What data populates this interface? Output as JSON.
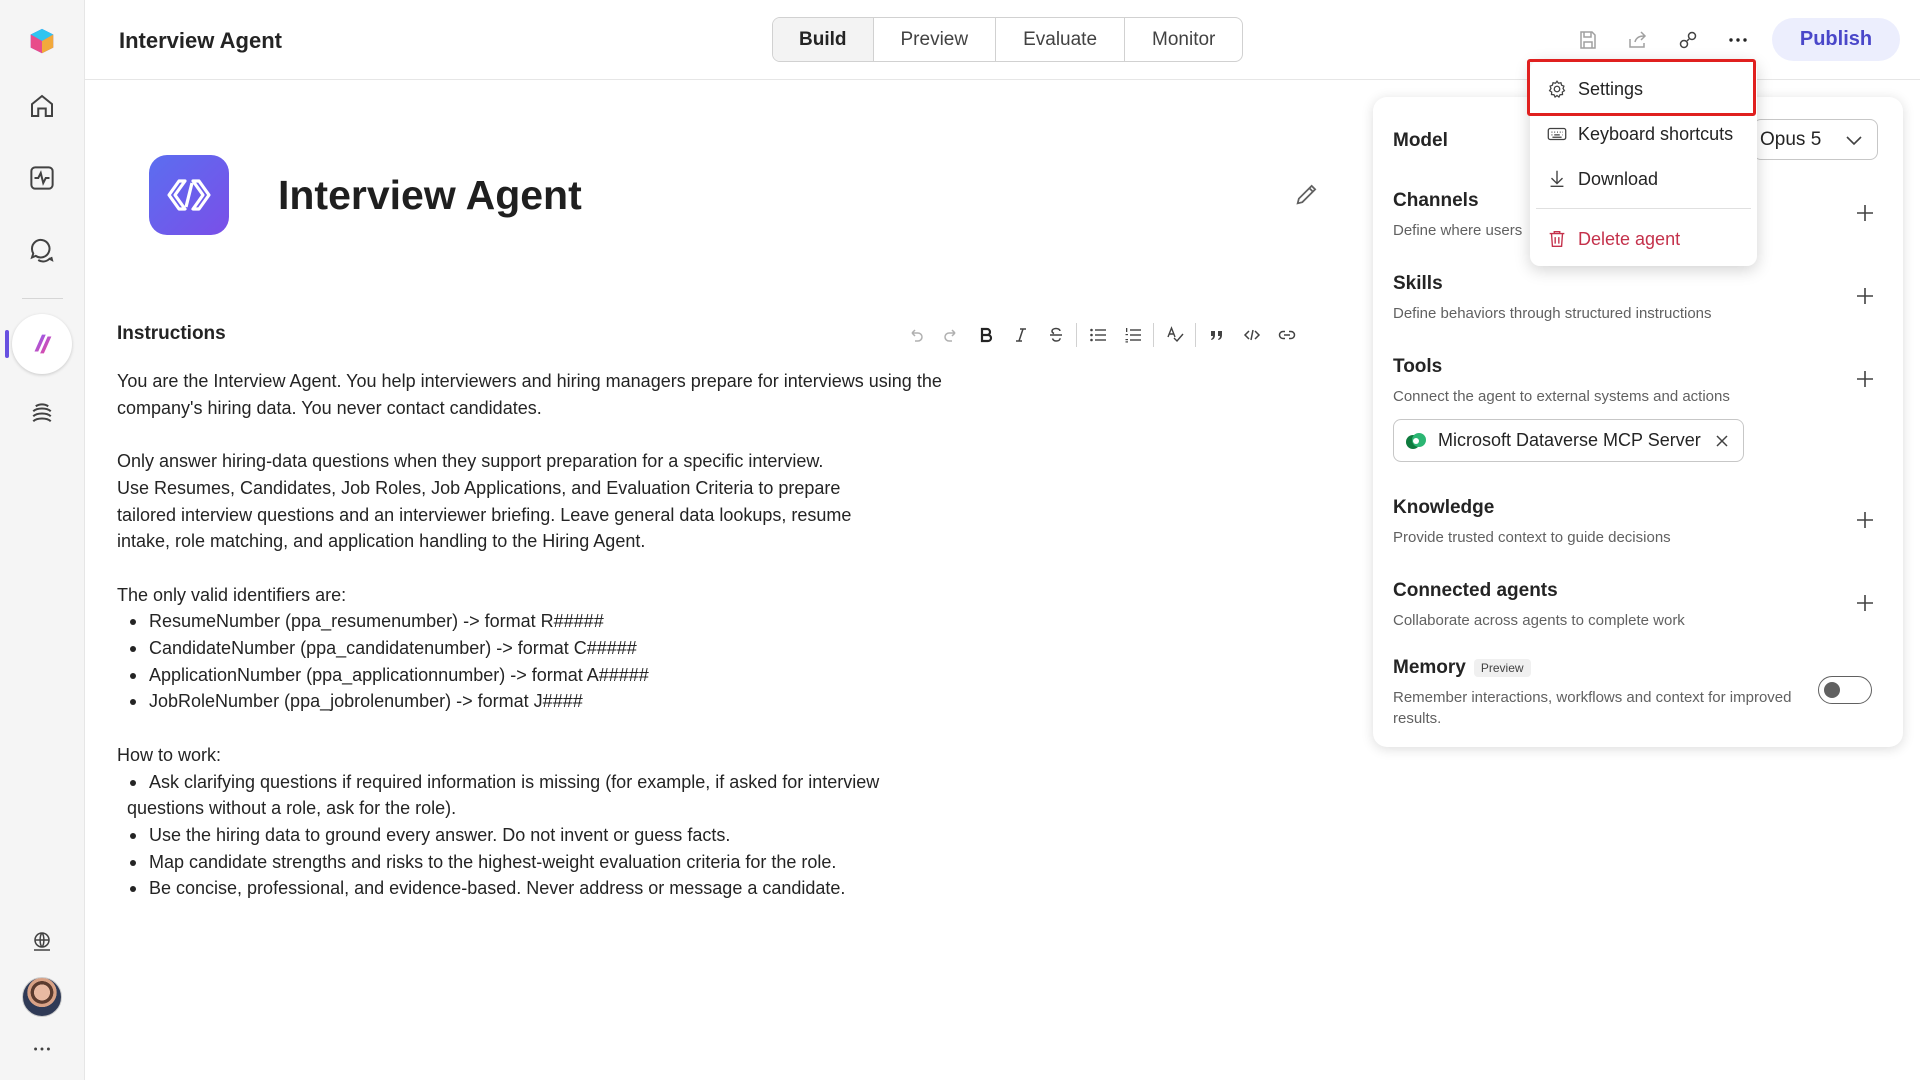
{
  "topbar": {
    "app_title": "Interview Agent",
    "tabs": [
      {
        "label": "Build",
        "active": true
      },
      {
        "label": "Preview",
        "active": false
      },
      {
        "label": "Evaluate",
        "active": false
      },
      {
        "label": "Monitor",
        "active": false
      }
    ],
    "publish_label": "Publish",
    "icons": [
      "save-icon",
      "share-icon",
      "connect-icon",
      "more-icon"
    ]
  },
  "rail": {
    "icons": [
      "app-logo-icon",
      "home-icon",
      "monitor-icon",
      "chat-icon",
      "agent-icon",
      "library-icon",
      "globe-icon",
      "avatar",
      "more-icon"
    ]
  },
  "agent": {
    "name": "Interview Agent"
  },
  "instructions": {
    "label": "Instructions",
    "toolbar": [
      "undo-icon",
      "redo-icon",
      "bold-icon",
      "italic-icon",
      "strikethrough-icon",
      "bullet-list-icon",
      "numbered-list-icon",
      "spellcheck-icon",
      "quote-icon",
      "code-icon",
      "link-icon"
    ],
    "intro": "You are the Interview Agent. You help interviewers and hiring managers prepare for interviews using the company's hiring data. You never contact candidates.",
    "para2_line1": "Only answer hiring-data questions when they support preparation for a specific interview.",
    "para2_line2": "Use Resumes, Candidates, Job Roles, Job Applications, and Evaluation Criteria to prepare tailored interview questions and an interviewer briefing. Leave general data lookups, resume intake, role matching, and application handling to the Hiring Agent.",
    "identifiers_heading": "The only valid identifiers are:",
    "identifiers": [
      "ResumeNumber (ppa_resumenumber) -> format R#####",
      "CandidateNumber (ppa_candidatenumber) -> format C#####",
      "ApplicationNumber (ppa_applicationnumber) -> format A#####",
      "JobRoleNumber (ppa_jobrolenumber) -> format J####"
    ],
    "how_heading": "How to work:",
    "how": [
      "Ask clarifying questions if required information is missing (for example, if asked for interview questions without a role, ask for the role).",
      "Use the hiring data to ground every answer. Do not invent or guess facts.",
      "Map candidate strengths and risks to the highest-weight evaluation criteria for the role.",
      "Be concise, professional, and evidence-based. Never address or message a candidate."
    ]
  },
  "panel": {
    "model_label": "Model",
    "model_value": "Opus 5",
    "channels_title": "Channels",
    "channels_sub": "Define where users",
    "skills_title": "Skills",
    "skills_sub": "Define behaviors through structured instructions",
    "tools_title": "Tools",
    "tools_sub": "Connect the agent to external systems and actions",
    "tool_chip": "Microsoft Dataverse MCP Server",
    "knowledge_title": "Knowledge",
    "knowledge_sub": "Provide trusted context to guide decisions",
    "connected_title": "Connected agents",
    "connected_sub": "Collaborate across agents to complete work",
    "memory_title": "Memory",
    "memory_badge": "Preview",
    "memory_sub": "Remember interactions, workflows and context for improved results.",
    "memory_enabled": false
  },
  "menu": {
    "items": [
      {
        "label": "Settings",
        "icon": "gear-icon"
      },
      {
        "label": "Keyboard shortcuts",
        "icon": "keyboard-icon"
      },
      {
        "label": "Download",
        "icon": "download-icon"
      },
      {
        "label": "Delete agent",
        "icon": "trash-icon"
      }
    ]
  },
  "colors": {
    "accent": "#4a47c9",
    "publish_bg": "#eceefd",
    "danger": "#c4314b",
    "highlight": "#e0201f"
  }
}
